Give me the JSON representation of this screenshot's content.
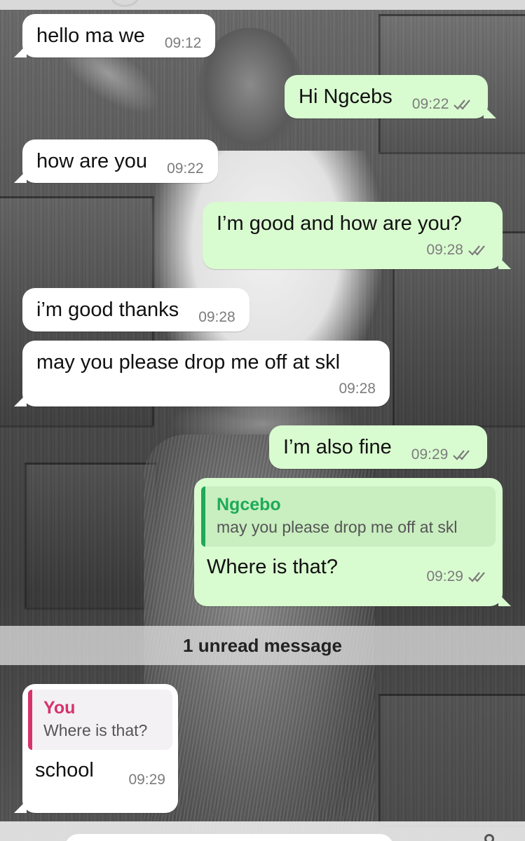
{
  "messages": [
    {
      "id": "m1",
      "direction": "in",
      "text": "hello ma we",
      "time": "09:12"
    },
    {
      "id": "m2",
      "direction": "out",
      "text": "Hi Ngcebs",
      "time": "09:22",
      "status": "read"
    },
    {
      "id": "m3",
      "direction": "in",
      "text": "how are you",
      "time": "09:22"
    },
    {
      "id": "m4",
      "direction": "out",
      "text": "I’m good and how are you?",
      "time": "09:28",
      "status": "read"
    },
    {
      "id": "m5",
      "direction": "in",
      "text": "i’m good thanks",
      "time": "09:28"
    },
    {
      "id": "m6",
      "direction": "in",
      "text": "may you please drop me off at skl",
      "time": "09:28"
    },
    {
      "id": "m7",
      "direction": "out",
      "text": "I’m also fine",
      "time": "09:29",
      "status": "read"
    },
    {
      "id": "m8",
      "direction": "out",
      "text": "Where is that?",
      "time": "09:29",
      "status": "read",
      "quote": {
        "author": "Ngcebo",
        "text": "may you please drop me off at skl"
      }
    },
    {
      "id": "m9",
      "direction": "in",
      "text": "school",
      "time": "09:29",
      "quote": {
        "author": "You",
        "text": "Where is that?"
      }
    }
  ],
  "unread_banner": "1 unread message",
  "colors": {
    "incoming_bubble": "#ffffff",
    "outgoing_bubble": "#d9fbd0",
    "quote_ngcebo_accent": "#1faa59",
    "quote_you_accent": "#d6336c",
    "read_tick": "#7c7c7c"
  },
  "icons": {
    "read_receipt": "double-check-icon"
  }
}
